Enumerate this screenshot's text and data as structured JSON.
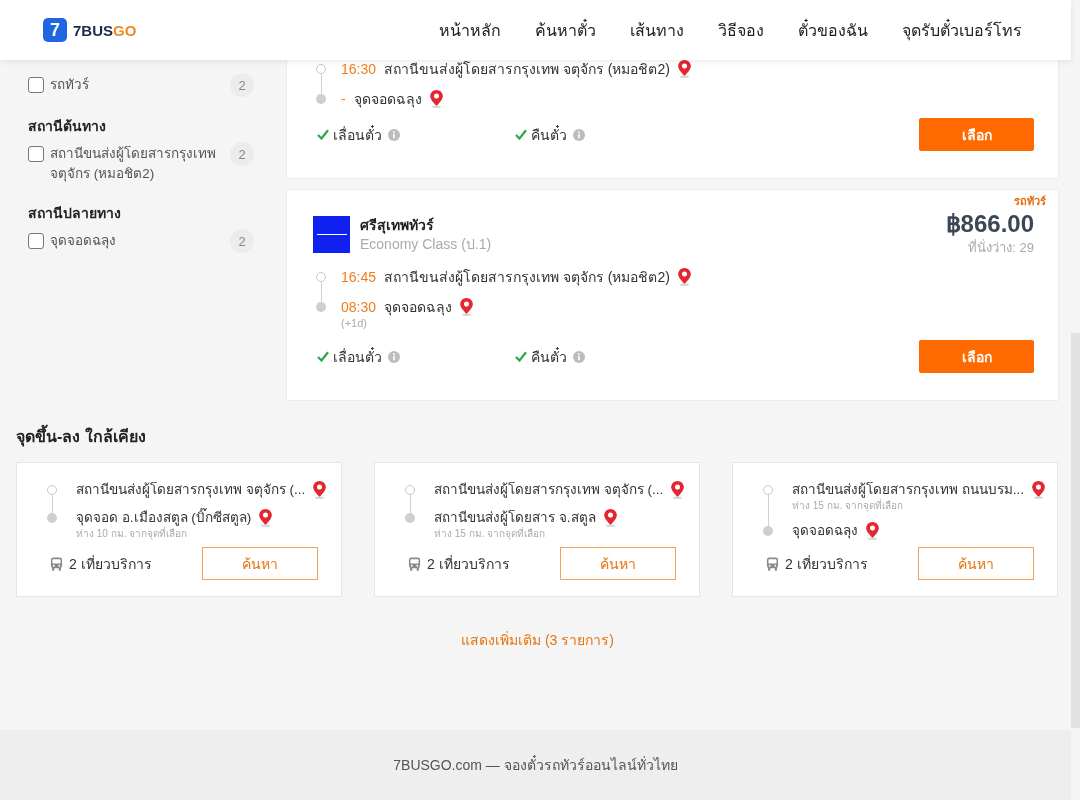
{
  "header": {
    "logo": {
      "mark": "7",
      "wordmark": [
        {
          "text": "7BUS",
          "accent": false
        },
        {
          "text": "GO",
          "accent": true
        }
      ]
    },
    "nav": [
      "หน้าหลัก",
      "ค้นหาตั๋ว",
      "เส้นทาง",
      "วิธีจอง",
      "ตั๋วของฉัน",
      "จุดรับตั๋วเบอร์โทร"
    ]
  },
  "sidebar": {
    "filter_groups": [
      {
        "items": [
          {
            "label": "รถทัวร์",
            "count": "2",
            "checked": false
          }
        ]
      },
      {
        "heading": "สถานีต้นทาง",
        "items": [
          {
            "label": "สถานีขนส่งผู้โดยสารกรุงเทพ จตุจักร (หมอชิต2)",
            "count": "2",
            "checked": false
          }
        ]
      },
      {
        "heading": "สถานีปลายทาง",
        "items": [
          {
            "label": "จุดจอดฉลุง",
            "count": "2",
            "checked": false
          }
        ]
      }
    ]
  },
  "trips": [
    {
      "stops": [
        {
          "kind": "departure",
          "time": "16:30",
          "place": "สถานีขนส่งผู้โดยสารกรุงเทพ จตุจักร (หมอชิต2)"
        },
        {
          "kind": "arrival",
          "time": "-",
          "place": "จุดจอดฉลุง"
        }
      ],
      "features": [
        {
          "label": "เลื่อนตั๋ว",
          "available": true
        },
        {
          "label": "คืนตั๋ว",
          "available": true
        }
      ],
      "button": "เลือก"
    },
    {
      "tag": "รถทัวร์",
      "operator": "ศรีสุเทพทัวร์",
      "class": "Economy Class (ป.1)",
      "price": "฿866.00",
      "seats": "ที่นั่งว่าง: 29",
      "stops": [
        {
          "kind": "departure",
          "time": "16:45",
          "place": "สถานีขนส่งผู้โดยสารกรุงเทพ จตุจักร (หมอชิต2)"
        },
        {
          "kind": "arrival",
          "time": "08:30",
          "day_offset": "(+1d)",
          "place": "จุดจอดฉลุง"
        }
      ],
      "features": [
        {
          "label": "เลื่อนตั๋ว",
          "available": true
        },
        {
          "label": "คืนตั๋ว",
          "available": true
        }
      ],
      "button": "เลือก"
    }
  ],
  "nearby": {
    "title": "จุดขึ้น-ลง ใกล้เคียง",
    "cards": [
      {
        "stops": [
          {
            "kind": "departure",
            "place": "สถานีขนส่งผู้โดยสารกรุงเทพ จตุจักร (..."
          },
          {
            "kind": "arrival",
            "place": "จุดจอด อ.เมืองสตูล (บิ๊กซีสตูล)",
            "note": "ห่าง 10 กม. จากจุดที่เลือก"
          }
        ],
        "trips": "2 เที่ยวบริการ",
        "button": "ค้นหา"
      },
      {
        "stops": [
          {
            "kind": "departure",
            "place": "สถานีขนส่งผู้โดยสารกรุงเทพ จตุจักร (..."
          },
          {
            "kind": "arrival",
            "place": "สถานีขนส่งผู้โดยสาร จ.สตูล",
            "note": "ห่าง 15 กม. จากจุดที่เลือก"
          }
        ],
        "trips": "2 เที่ยวบริการ",
        "button": "ค้นหา"
      },
      {
        "stops": [
          {
            "kind": "departure",
            "place": "สถานีขนส่งผู้โดยสารกรุงเทพ ถนนบรม...",
            "note": "ห่าง 15 กม. จากจุดที่เลือก"
          },
          {
            "kind": "arrival",
            "place": "จุดจอดฉลุง"
          }
        ],
        "trips": "2 เที่ยวบริการ",
        "button": "ค้นหา"
      }
    ]
  },
  "show_more": "แสดงเพิ่มเติม (3 รายการ)",
  "footer": "7BUSGO.com — จองตั๋วรถทัวร์ออนไลน์ทั่วไทย"
}
